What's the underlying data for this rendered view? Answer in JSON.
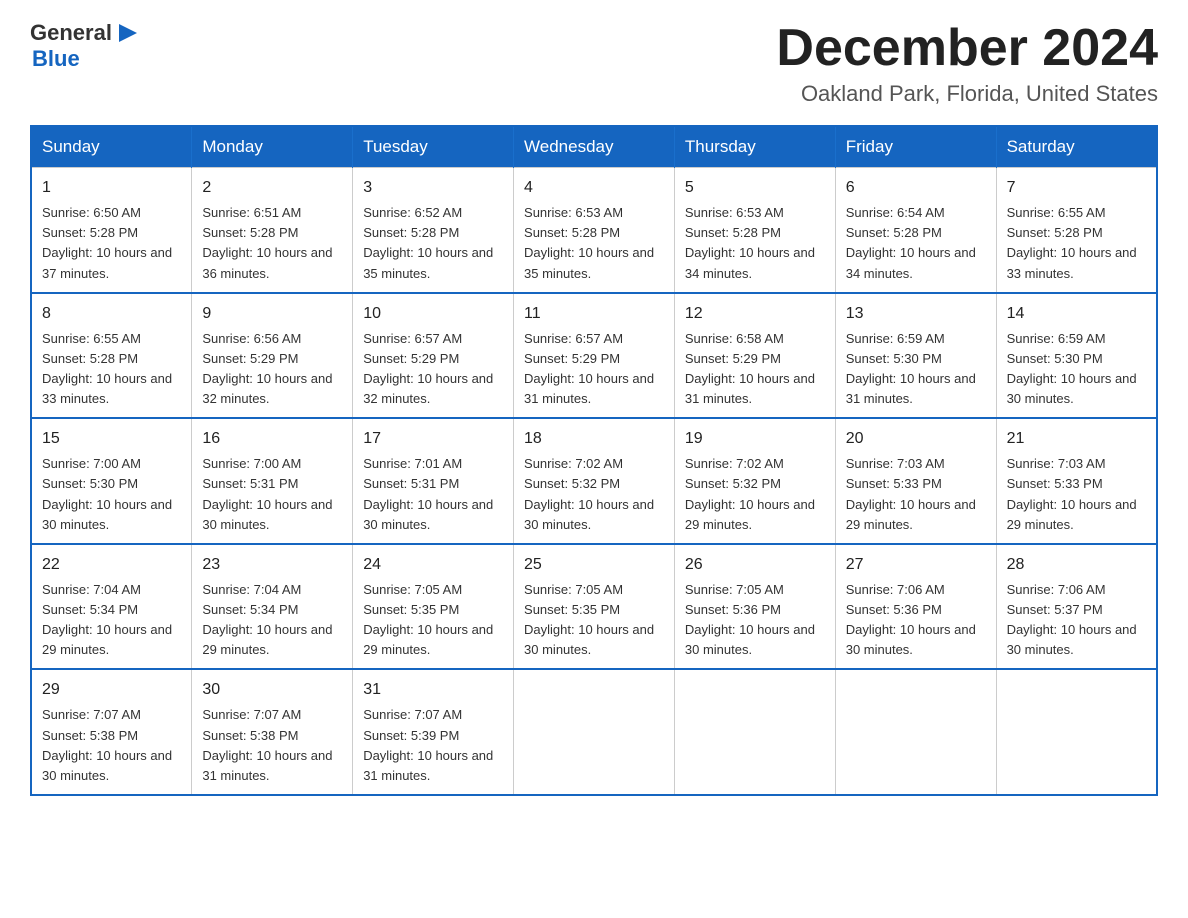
{
  "logo": {
    "general": "General",
    "blue": "Blue",
    "arrow_char": "▶"
  },
  "header": {
    "month_title": "December 2024",
    "location": "Oakland Park, Florida, United States"
  },
  "weekdays": [
    "Sunday",
    "Monday",
    "Tuesday",
    "Wednesday",
    "Thursday",
    "Friday",
    "Saturday"
  ],
  "weeks": [
    [
      {
        "day": "1",
        "sunrise": "6:50 AM",
        "sunset": "5:28 PM",
        "daylight": "10 hours and 37 minutes."
      },
      {
        "day": "2",
        "sunrise": "6:51 AM",
        "sunset": "5:28 PM",
        "daylight": "10 hours and 36 minutes."
      },
      {
        "day": "3",
        "sunrise": "6:52 AM",
        "sunset": "5:28 PM",
        "daylight": "10 hours and 35 minutes."
      },
      {
        "day": "4",
        "sunrise": "6:53 AM",
        "sunset": "5:28 PM",
        "daylight": "10 hours and 35 minutes."
      },
      {
        "day": "5",
        "sunrise": "6:53 AM",
        "sunset": "5:28 PM",
        "daylight": "10 hours and 34 minutes."
      },
      {
        "day": "6",
        "sunrise": "6:54 AM",
        "sunset": "5:28 PM",
        "daylight": "10 hours and 34 minutes."
      },
      {
        "day": "7",
        "sunrise": "6:55 AM",
        "sunset": "5:28 PM",
        "daylight": "10 hours and 33 minutes."
      }
    ],
    [
      {
        "day": "8",
        "sunrise": "6:55 AM",
        "sunset": "5:28 PM",
        "daylight": "10 hours and 33 minutes."
      },
      {
        "day": "9",
        "sunrise": "6:56 AM",
        "sunset": "5:29 PM",
        "daylight": "10 hours and 32 minutes."
      },
      {
        "day": "10",
        "sunrise": "6:57 AM",
        "sunset": "5:29 PM",
        "daylight": "10 hours and 32 minutes."
      },
      {
        "day": "11",
        "sunrise": "6:57 AM",
        "sunset": "5:29 PM",
        "daylight": "10 hours and 31 minutes."
      },
      {
        "day": "12",
        "sunrise": "6:58 AM",
        "sunset": "5:29 PM",
        "daylight": "10 hours and 31 minutes."
      },
      {
        "day": "13",
        "sunrise": "6:59 AM",
        "sunset": "5:30 PM",
        "daylight": "10 hours and 31 minutes."
      },
      {
        "day": "14",
        "sunrise": "6:59 AM",
        "sunset": "5:30 PM",
        "daylight": "10 hours and 30 minutes."
      }
    ],
    [
      {
        "day": "15",
        "sunrise": "7:00 AM",
        "sunset": "5:30 PM",
        "daylight": "10 hours and 30 minutes."
      },
      {
        "day": "16",
        "sunrise": "7:00 AM",
        "sunset": "5:31 PM",
        "daylight": "10 hours and 30 minutes."
      },
      {
        "day": "17",
        "sunrise": "7:01 AM",
        "sunset": "5:31 PM",
        "daylight": "10 hours and 30 minutes."
      },
      {
        "day": "18",
        "sunrise": "7:02 AM",
        "sunset": "5:32 PM",
        "daylight": "10 hours and 30 minutes."
      },
      {
        "day": "19",
        "sunrise": "7:02 AM",
        "sunset": "5:32 PM",
        "daylight": "10 hours and 29 minutes."
      },
      {
        "day": "20",
        "sunrise": "7:03 AM",
        "sunset": "5:33 PM",
        "daylight": "10 hours and 29 minutes."
      },
      {
        "day": "21",
        "sunrise": "7:03 AM",
        "sunset": "5:33 PM",
        "daylight": "10 hours and 29 minutes."
      }
    ],
    [
      {
        "day": "22",
        "sunrise": "7:04 AM",
        "sunset": "5:34 PM",
        "daylight": "10 hours and 29 minutes."
      },
      {
        "day": "23",
        "sunrise": "7:04 AM",
        "sunset": "5:34 PM",
        "daylight": "10 hours and 29 minutes."
      },
      {
        "day": "24",
        "sunrise": "7:05 AM",
        "sunset": "5:35 PM",
        "daylight": "10 hours and 29 minutes."
      },
      {
        "day": "25",
        "sunrise": "7:05 AM",
        "sunset": "5:35 PM",
        "daylight": "10 hours and 30 minutes."
      },
      {
        "day": "26",
        "sunrise": "7:05 AM",
        "sunset": "5:36 PM",
        "daylight": "10 hours and 30 minutes."
      },
      {
        "day": "27",
        "sunrise": "7:06 AM",
        "sunset": "5:36 PM",
        "daylight": "10 hours and 30 minutes."
      },
      {
        "day": "28",
        "sunrise": "7:06 AM",
        "sunset": "5:37 PM",
        "daylight": "10 hours and 30 minutes."
      }
    ],
    [
      {
        "day": "29",
        "sunrise": "7:07 AM",
        "sunset": "5:38 PM",
        "daylight": "10 hours and 30 minutes."
      },
      {
        "day": "30",
        "sunrise": "7:07 AM",
        "sunset": "5:38 PM",
        "daylight": "10 hours and 31 minutes."
      },
      {
        "day": "31",
        "sunrise": "7:07 AM",
        "sunset": "5:39 PM",
        "daylight": "10 hours and 31 minutes."
      },
      null,
      null,
      null,
      null
    ]
  ]
}
